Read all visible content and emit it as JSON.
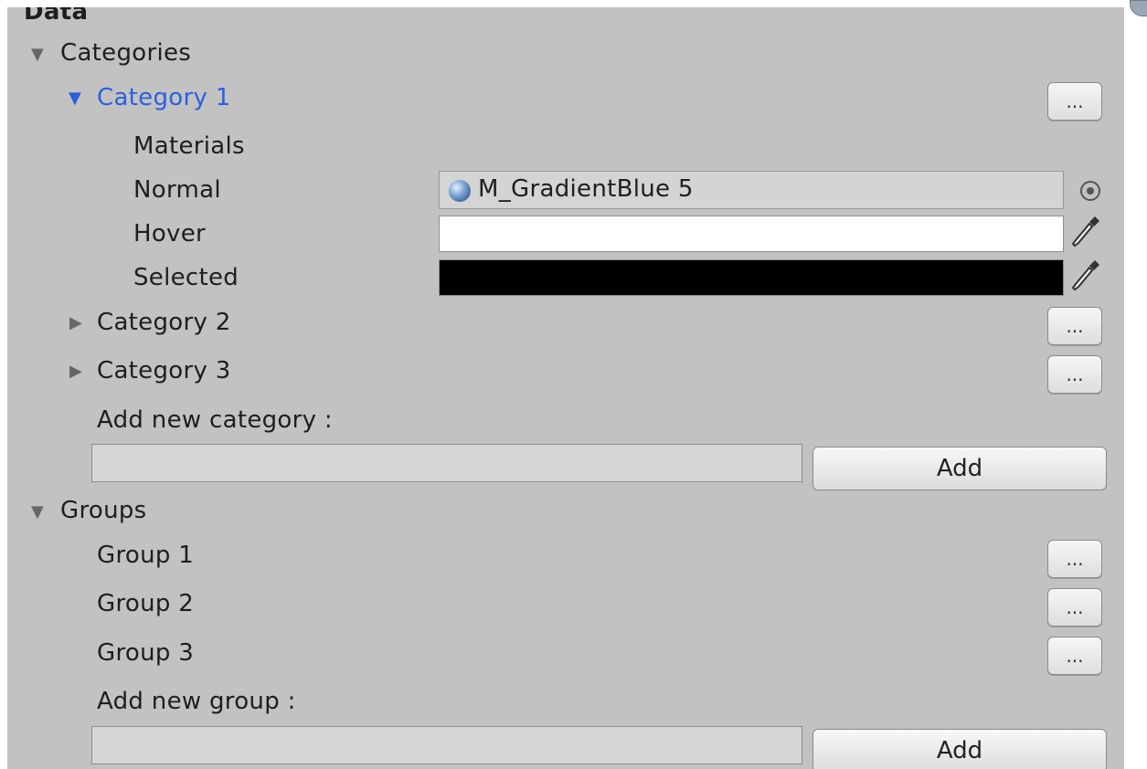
{
  "section_title": "Data",
  "categories": {
    "header": "Categories",
    "items": [
      {
        "label": "Category 1",
        "button": "..."
      },
      {
        "label": "Category 2",
        "button": "..."
      },
      {
        "label": "Category 3",
        "button": "..."
      }
    ],
    "expanded": {
      "materials_label": "Materials",
      "normal_label": "Normal",
      "normal_value": "M_GradientBlue 5",
      "hover_label": "Hover",
      "hover_color": "#ffffff",
      "selected_label": "Selected",
      "selected_color": "#000000"
    },
    "add_label": "Add new category :",
    "add_input_value": "",
    "add_button": "Add"
  },
  "groups": {
    "header": "Groups",
    "items": [
      {
        "label": "Group 1",
        "button": "..."
      },
      {
        "label": "Group 2",
        "button": "..."
      },
      {
        "label": "Group 3",
        "button": "..."
      }
    ],
    "add_label": "Add new group :",
    "add_input_value": "",
    "add_button": "Add"
  },
  "icons": {
    "collapse": "triangle-down-icon",
    "expand": "triangle-right-icon",
    "material": "material-sphere-icon",
    "object_picker": "object-picker-icon",
    "eyedropper": "eyedropper-icon"
  },
  "colors": {
    "panel_bg": "#c2c2c2",
    "selected_text": "#2b5fdf"
  }
}
